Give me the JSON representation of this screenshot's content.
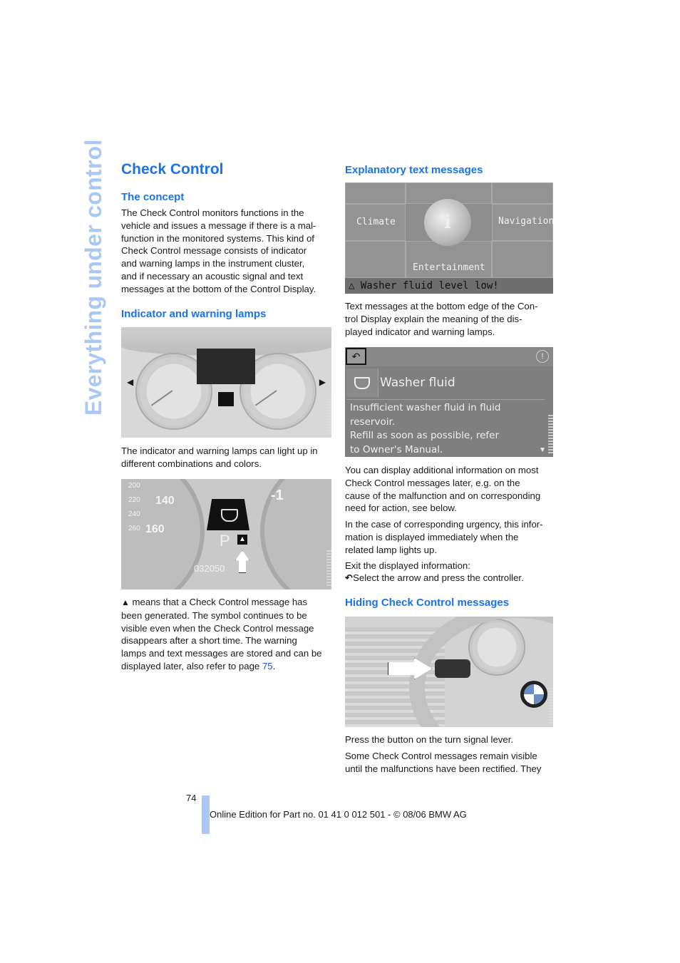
{
  "side_title": "Everything under control",
  "title": "Check Control",
  "left_column": {
    "concept": {
      "heading": "The concept",
      "body": "The Check Control monitors functions in the\nvehicle and issues a message if there is a mal-\nfunction in the monitored systems. This kind of\nCheck Control message consists of indicator\nand warning lamps in the instrument cluster,\nand if necessary an acoustic signal and text\nmessages at the bottom of the Control Display."
    },
    "lamps": {
      "heading": "Indicator and warning lamps",
      "figure1_icon": "instrument-cluster-image",
      "caption": "The indicator and warning lamps can light up in\ndifferent combinations and colors.",
      "figure2": {
        "speed_ticks": [
          "200",
          "220",
          "240",
          "260"
        ],
        "speed_major": [
          "140",
          "160"
        ],
        "odometer": "032050",
        "gear": "P",
        "right_gauge_value": "-1"
      },
      "warning_icon": "warning-triangle-icon",
      "symbol_text": " means that a Check Control message has\nbeen generated. The symbol continues to be\nvisible even when the Check Control message\ndisappears after a short time. The warning\nlamps and text messages are stored and can be\ndisplayed later, also refer to page ",
      "page_ref": "75",
      "symbol_end": "."
    }
  },
  "right_column": {
    "explanatory": {
      "heading": "Explanatory text messages",
      "menu": {
        "left": "Climate",
        "right": "Navigation",
        "bottom": "Entertainment",
        "center_icon": "info-icon",
        "status_icon": "warning-triangle-outline-icon",
        "status": "Washer fluid level low!"
      },
      "body": "Text messages at the bottom edge of the Con-\ntrol Display explain the meaning of the dis-\nplayed indicator and warning lamps."
    },
    "detail_screen": {
      "back_icon": "back-arrow-icon",
      "info_icon": "info-icon",
      "title": "Washer fluid",
      "lines": [
        "Insufficient washer fluid in fluid",
        "reservoir.",
        "Refill as soon as possible, refer",
        "to Owner's Manual."
      ]
    },
    "para1": "You can display additional information on most\nCheck Control messages later, e.g. on the\ncause of the malfunction and on corresponding\nneed for action, see below.",
    "para2": "In the case of corresponding urgency, this infor-\nmation is displayed immediately when the\nrelated lamp lights up.",
    "exit_label": "Exit the displayed information:",
    "exit_step": "Select the arrow and press the controller.",
    "hiding": {
      "heading": "Hiding Check Control messages",
      "figure_icon": "steering-wheel-turn-signal-image",
      "para1": "Press the button on the turn signal lever.",
      "para2": "Some Check Control messages remain visible\nuntil the malfunctions have been rectified. They"
    }
  },
  "footer": {
    "page_number": "74",
    "edition": "Online Edition for Part no. 01 41 0 012 501 - © 08/06 BMW AG"
  },
  "colors": {
    "heading_blue": "#1a73e8",
    "side_title": "#a9c8f3",
    "link": "#1a55d8"
  }
}
